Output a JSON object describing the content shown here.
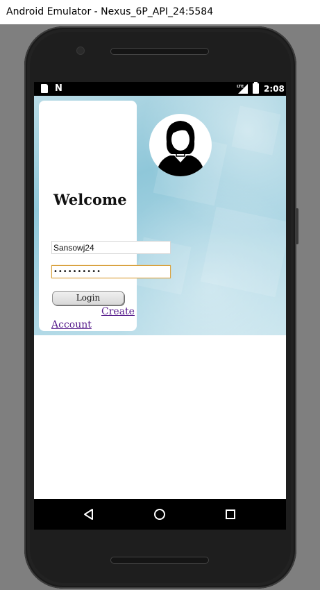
{
  "window": {
    "title": "Android Emulator - Nexus_6P_API_24:5584"
  },
  "status_bar": {
    "time": "2:08",
    "notification_icons": [
      "sd-card-icon",
      "n-notification-icon"
    ],
    "system_icons": [
      "lte-signal-icon",
      "battery-icon"
    ]
  },
  "app": {
    "welcome_heading": "Welcome",
    "username": {
      "value": "Sansowj24",
      "placeholder": ""
    },
    "password": {
      "value": "••••••••••",
      "placeholder": ""
    },
    "login_button": "Login",
    "create_account": {
      "line1": "Create",
      "line2": "Account"
    },
    "avatar_icon": "user-silhouette-icon"
  },
  "nav_bar": {
    "buttons": [
      "back-icon",
      "home-icon",
      "recents-icon"
    ]
  },
  "colors": {
    "link": "#551a8b",
    "focus_border": "#d9a342",
    "background_accent": "#8fc7d9"
  }
}
